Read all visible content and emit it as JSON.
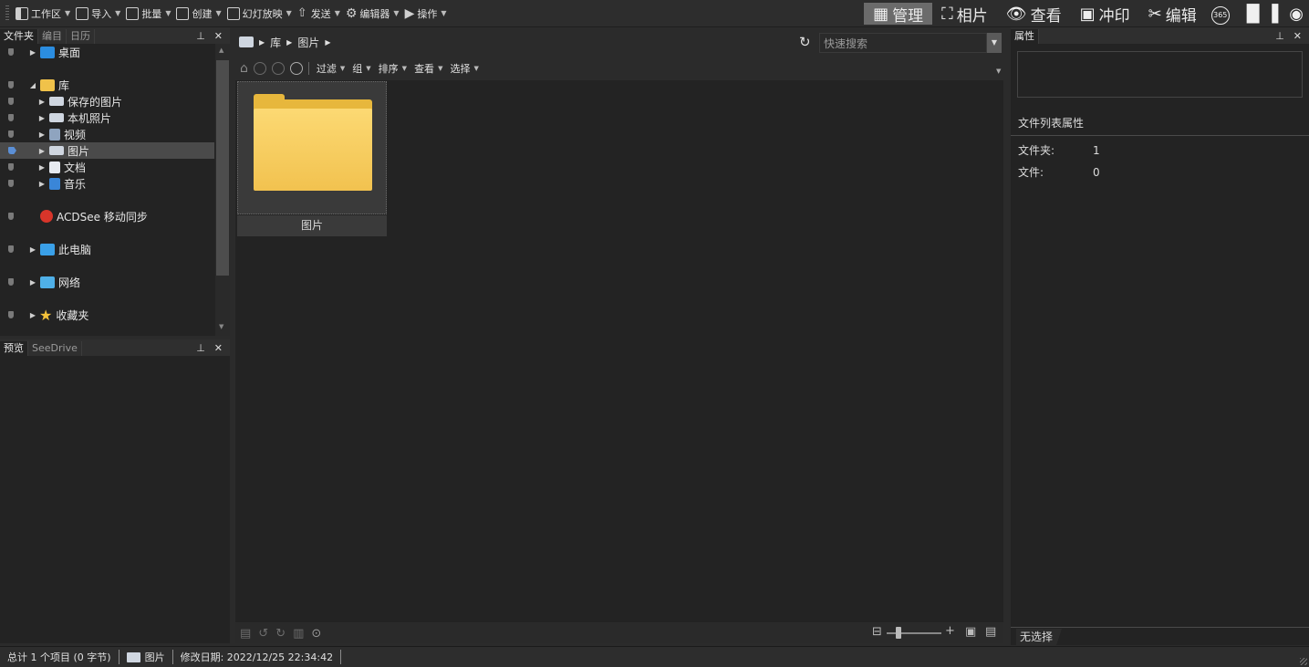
{
  "toolbar": {
    "items": [
      {
        "label": "工作区",
        "icon": "workspace-icon"
      },
      {
        "label": "导入",
        "icon": "import-icon"
      },
      {
        "label": "批量",
        "icon": "batch-icon"
      },
      {
        "label": "创建",
        "icon": "create-icon"
      },
      {
        "label": "幻灯放映",
        "icon": "slideshow-icon"
      },
      {
        "label": "发送",
        "icon": "send-icon"
      },
      {
        "label": "编辑器",
        "icon": "editor-icon"
      },
      {
        "label": "操作",
        "icon": "action-icon"
      }
    ],
    "modes": {
      "manage": "管理",
      "photos": "相片",
      "view": "查看",
      "develop": "冲印",
      "edit": "编辑",
      "badge_365": "365"
    }
  },
  "left_panel": {
    "tabs": [
      "文件夹",
      "编目",
      "日历"
    ],
    "tree": {
      "desktop": "桌面",
      "library": "库",
      "saved_pictures": "保存的图片",
      "camera_roll": "本机照片",
      "videos": "视频",
      "pictures": "图片",
      "documents": "文档",
      "music": "音乐",
      "acdsee_sync": "ACDSee 移动同步",
      "this_pc": "此电脑",
      "network": "网络",
      "favorites": "收藏夹"
    }
  },
  "preview_panel": {
    "tabs": [
      "预览",
      "SeeDrive"
    ]
  },
  "address": {
    "crumbs": [
      "库",
      "图片"
    ],
    "search_placeholder": "快速搜索"
  },
  "subbar": {
    "filter": "过滤",
    "group": "组",
    "sort": "排序",
    "view": "查看",
    "select": "选择"
  },
  "content": {
    "items": [
      {
        "label": "图片"
      }
    ]
  },
  "right_panel": {
    "tab": "属性",
    "section_title": "文件列表属性",
    "folders_label": "文件夹:",
    "folders_value": "1",
    "files_label": "文件:",
    "files_value": "0",
    "bottom_tab": "无选择"
  },
  "status": {
    "total": "总计 1 个项目 (0 字节)",
    "current": "图片",
    "modified": "修改日期: 2022/12/25 22:34:42"
  },
  "colors": {
    "accent_selection": "#4a4a4a",
    "folder": "#f2c24f",
    "pin_active": "#5b8fd6"
  }
}
